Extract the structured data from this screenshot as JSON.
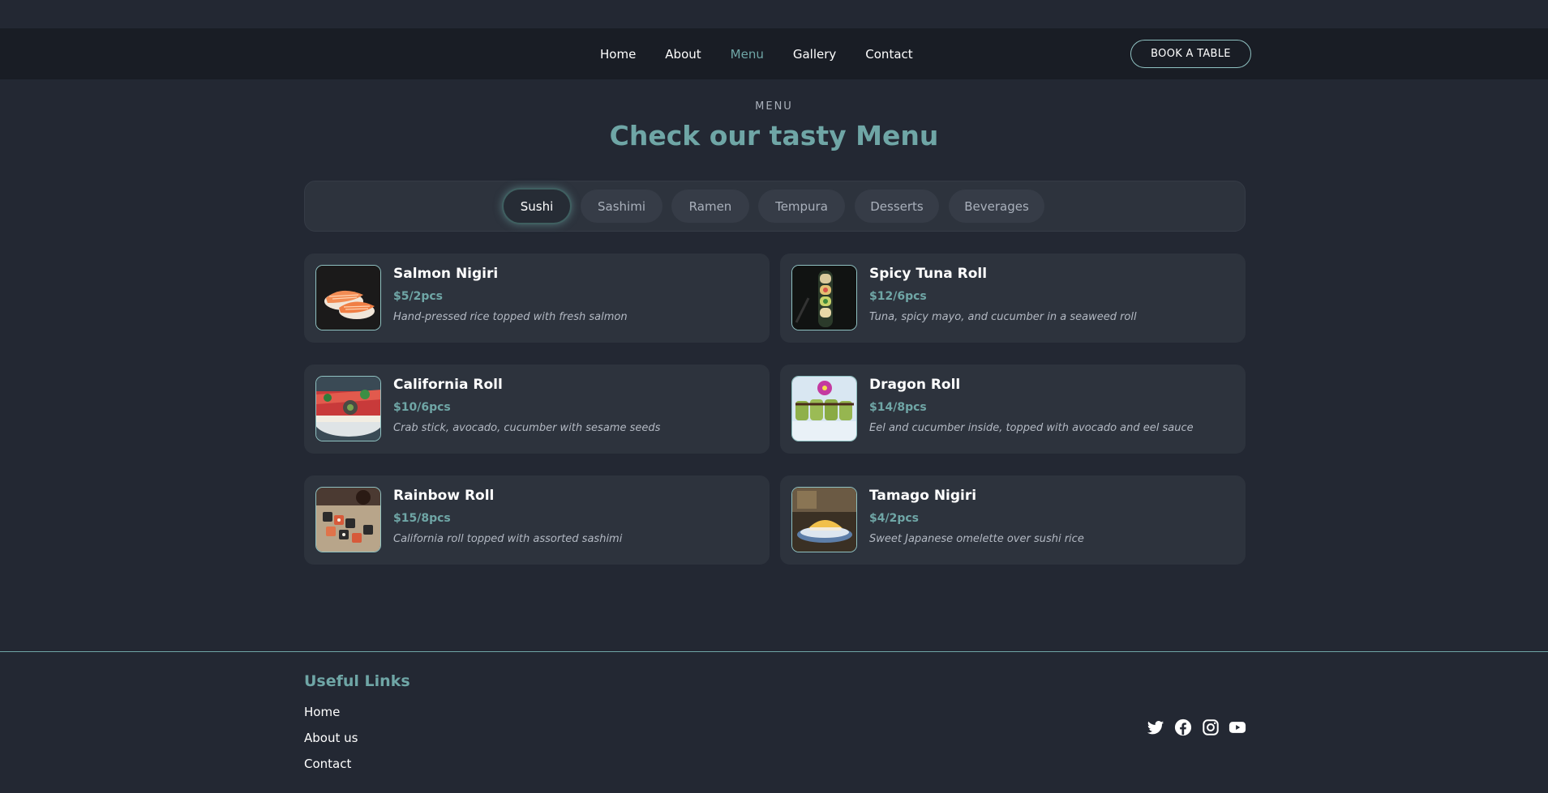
{
  "nav": {
    "links": [
      "Home",
      "About",
      "Menu",
      "Gallery",
      "Contact"
    ],
    "active": "Menu",
    "cta_label": "BOOK A TABLE"
  },
  "section": {
    "tag": "MENU",
    "title": "Check our tasty Menu"
  },
  "tabs": [
    "Sushi",
    "Sashimi",
    "Ramen",
    "Tempura",
    "Desserts",
    "Beverages"
  ],
  "active_tab": "Sushi",
  "items": [
    {
      "name": "Salmon Nigiri",
      "price": "$5/2pcs",
      "description": "Hand-pressed rice topped with fresh salmon",
      "image": "salmon-nigiri-photo"
    },
    {
      "name": "Spicy Tuna Roll",
      "price": "$12/6pcs",
      "description": "Tuna, spicy mayo, and cucumber in a seaweed roll",
      "image": "spicy-tuna-roll-photo"
    },
    {
      "name": "California Roll",
      "price": "$10/6pcs",
      "description": "Crab stick, avocado, cucumber with sesame seeds",
      "image": "california-roll-photo"
    },
    {
      "name": "Dragon Roll",
      "price": "$14/8pcs",
      "description": "Eel and cucumber inside, topped with avocado and eel sauce",
      "image": "dragon-roll-photo"
    },
    {
      "name": "Rainbow Roll",
      "price": "$15/8pcs",
      "description": "California roll topped with assorted sashimi",
      "image": "rainbow-roll-photo"
    },
    {
      "name": "Tamago Nigiri",
      "price": "$4/2pcs",
      "description": "Sweet Japanese omelette over sushi rice",
      "image": "tamago-nigiri-photo"
    }
  ],
  "footer": {
    "title": "Useful Links",
    "links": [
      "Home",
      "About us",
      "Contact"
    ],
    "social_icons": [
      "twitter-icon",
      "facebook-icon",
      "instagram-icon",
      "youtube-icon"
    ]
  },
  "colors": {
    "background": "#232833",
    "navbar": "#191d25",
    "accent": "#6fa6a6",
    "card": "#2d333d"
  }
}
